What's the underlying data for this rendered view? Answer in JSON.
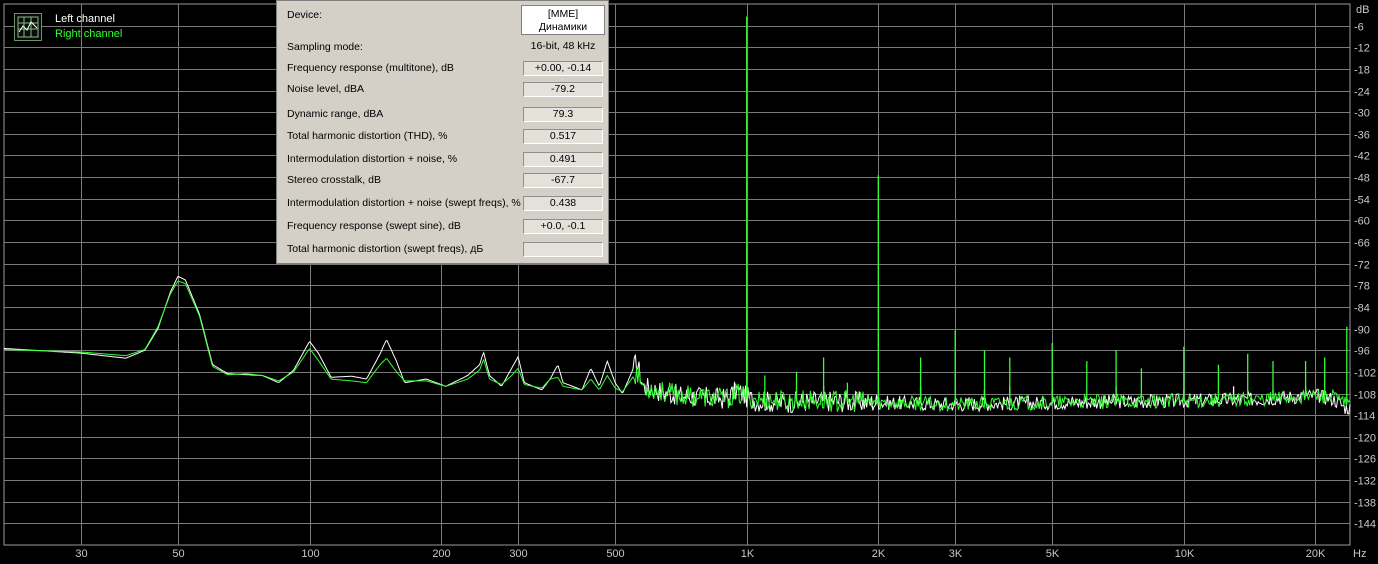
{
  "legend": {
    "items": [
      {
        "label": "Left channel",
        "color": "#ffffff"
      },
      {
        "label": "Right channel",
        "color": "#33ff33"
      }
    ]
  },
  "panel": {
    "device_label": "Device:",
    "device_value_line1": "[MME]",
    "device_value_line2": "Динамики",
    "rows": [
      {
        "label": "Sampling mode:",
        "value": "16-bit, 48 kHz",
        "boxed": false
      },
      {
        "label": "Frequency response (multitone), dB",
        "value": "+0.00, -0.14",
        "boxed": true
      },
      {
        "label": "Noise level, dBA",
        "value": "-79.2",
        "boxed": true
      },
      {
        "label": "Dynamic range, dBA",
        "value": "79.3",
        "boxed": true
      },
      {
        "label": "Total harmonic distortion (THD), %",
        "value": "0.517",
        "boxed": true
      },
      {
        "label": "Intermodulation distortion + noise, %",
        "value": "0.491",
        "boxed": true
      },
      {
        "label": "Stereo crosstalk, dB",
        "value": "-67.7",
        "boxed": true
      },
      {
        "label": "Intermodulation distortion + noise (swept freqs), %",
        "value": "0.438",
        "boxed": true
      },
      {
        "label": "Frequency response (swept sine), dB",
        "value": "+0.0, -0.1",
        "boxed": true
      },
      {
        "label": "Total harmonic distortion (swept freqs), дБ",
        "value": "",
        "boxed": true
      }
    ]
  },
  "chart_data": {
    "type": "line",
    "xscale": "log",
    "xlim": [
      20,
      24000
    ],
    "ylim": [
      -150,
      0
    ],
    "grid": true,
    "legend_position": "top-left",
    "xunit": "Hz",
    "yunit": "dB",
    "x_ticks": [
      {
        "v": 30,
        "label": "30"
      },
      {
        "v": 50,
        "label": "50"
      },
      {
        "v": 100,
        "label": "100"
      },
      {
        "v": 200,
        "label": "200"
      },
      {
        "v": 300,
        "label": "300"
      },
      {
        "v": 500,
        "label": "500"
      },
      {
        "v": 1000,
        "label": "1K"
      },
      {
        "v": 2000,
        "label": "2K"
      },
      {
        "v": 3000,
        "label": "3K"
      },
      {
        "v": 5000,
        "label": "5K"
      },
      {
        "v": 10000,
        "label": "10K"
      },
      {
        "v": 20000,
        "label": "20K"
      }
    ],
    "y_ticks": [
      -6,
      -12,
      -18,
      -24,
      -30,
      -36,
      -42,
      -48,
      -54,
      -60,
      -66,
      -72,
      -78,
      -84,
      -90,
      -96,
      -102,
      -108,
      -114,
      -120,
      -126,
      -132,
      -138,
      -144
    ],
    "series": [
      {
        "name": "Left channel",
        "color": "#ffffff",
        "points": [
          [
            20,
            -95.5
          ],
          [
            30,
            -96.8
          ],
          [
            38,
            -98.2
          ],
          [
            42,
            -96
          ],
          [
            45,
            -90
          ],
          [
            48,
            -80
          ],
          [
            50,
            -75.5
          ],
          [
            52,
            -76.5
          ],
          [
            56,
            -86
          ],
          [
            60,
            -100
          ],
          [
            65,
            -102.5
          ],
          [
            72,
            -102.8
          ],
          [
            78,
            -103
          ],
          [
            85,
            -105
          ],
          [
            92,
            -101.5
          ],
          [
            100,
            -93.5
          ],
          [
            105,
            -97
          ],
          [
            112,
            -103.5
          ],
          [
            125,
            -103.2
          ],
          [
            135,
            -104
          ],
          [
            145,
            -97
          ],
          [
            150,
            -93
          ],
          [
            158,
            -99
          ],
          [
            165,
            -105
          ],
          [
            185,
            -104
          ],
          [
            205,
            -106
          ],
          [
            230,
            -103
          ],
          [
            245,
            -100
          ],
          [
            250,
            -96.5
          ],
          [
            258,
            -103
          ],
          [
            275,
            -106
          ],
          [
            290,
            -101
          ],
          [
            300,
            -97.8
          ],
          [
            310,
            -105
          ],
          [
            340,
            -107
          ],
          [
            355,
            -104
          ],
          [
            370,
            -100
          ],
          [
            380,
            -105
          ],
          [
            420,
            -107
          ],
          [
            440,
            -101
          ],
          [
            460,
            -106
          ],
          [
            480,
            -99
          ],
          [
            500,
            -105
          ],
          [
            520,
            -108
          ],
          [
            560,
            -99
          ],
          [
            580,
            -106
          ],
          [
            640,
            -107.5
          ],
          [
            700,
            -108.5
          ],
          [
            800,
            -109
          ],
          [
            900,
            -109.5
          ],
          [
            950,
            -107
          ],
          [
            1000,
            -109
          ],
          [
            1050,
            -110
          ],
          [
            1200,
            -110.5
          ],
          [
            1500,
            -110
          ],
          [
            2000,
            -110.5
          ],
          [
            3000,
            -111
          ],
          [
            5000,
            -110.5
          ],
          [
            10000,
            -110
          ],
          [
            15000,
            -109.5
          ],
          [
            20000,
            -108.5
          ],
          [
            22000,
            -109.5
          ],
          [
            23500,
            -112
          ]
        ],
        "harmonics": [
          [
            1500,
            -106
          ],
          [
            2500,
            -106
          ],
          [
            3500,
            -107
          ],
          [
            4000,
            -106
          ],
          [
            5000,
            -107
          ],
          [
            7000,
            -106
          ],
          [
            10000,
            -107
          ],
          [
            13000,
            -106
          ],
          [
            16000,
            -107
          ],
          [
            19000,
            -106
          ]
        ]
      },
      {
        "name": "Right channel",
        "color": "#33ff33",
        "points": [
          [
            20,
            -95.8
          ],
          [
            30,
            -96.5
          ],
          [
            38,
            -97.5
          ],
          [
            42,
            -95.8
          ],
          [
            45,
            -89.5
          ],
          [
            48,
            -80.5
          ],
          [
            50,
            -76.8
          ],
          [
            52,
            -77.5
          ],
          [
            56,
            -86.5
          ],
          [
            60,
            -100.5
          ],
          [
            65,
            -102.8
          ],
          [
            72,
            -102.5
          ],
          [
            78,
            -103
          ],
          [
            85,
            -104.5
          ],
          [
            92,
            -102
          ],
          [
            100,
            -95.5
          ],
          [
            105,
            -99
          ],
          [
            112,
            -104
          ],
          [
            125,
            -104.5
          ],
          [
            135,
            -105
          ],
          [
            145,
            -100
          ],
          [
            150,
            -98.2
          ],
          [
            158,
            -102
          ],
          [
            165,
            -104.5
          ],
          [
            185,
            -104.5
          ],
          [
            205,
            -106
          ],
          [
            230,
            -104
          ],
          [
            245,
            -101.5
          ],
          [
            250,
            -98.5
          ],
          [
            258,
            -104
          ],
          [
            275,
            -105.5
          ],
          [
            290,
            -103
          ],
          [
            300,
            -101
          ],
          [
            310,
            -105.5
          ],
          [
            340,
            -106.5
          ],
          [
            355,
            -104
          ],
          [
            370,
            -103.5
          ],
          [
            380,
            -106
          ],
          [
            420,
            -107
          ],
          [
            440,
            -104
          ],
          [
            460,
            -107
          ],
          [
            480,
            -103
          ],
          [
            500,
            -106.5
          ],
          [
            520,
            -107.5
          ],
          [
            560,
            -102
          ],
          [
            580,
            -106
          ],
          [
            640,
            -107.5
          ],
          [
            700,
            -108.5
          ],
          [
            800,
            -109
          ],
          [
            900,
            -109.5
          ],
          [
            950,
            -108
          ],
          [
            1000,
            -109
          ],
          [
            1050,
            -109.5
          ],
          [
            1200,
            -110
          ],
          [
            1500,
            -110
          ],
          [
            2000,
            -110.5
          ],
          [
            3000,
            -111
          ],
          [
            5000,
            -110.5
          ],
          [
            10000,
            -110
          ],
          [
            15000,
            -109.5
          ],
          [
            20000,
            -108.5
          ],
          [
            22000,
            -109
          ],
          [
            23500,
            -111
          ]
        ],
        "harmonics": [
          [
            1000,
            -3.5
          ],
          [
            1100,
            -103
          ],
          [
            1300,
            -102
          ],
          [
            1500,
            -98
          ],
          [
            1700,
            -105
          ],
          [
            2000,
            -47.5
          ],
          [
            2500,
            -98
          ],
          [
            3000,
            -90.5
          ],
          [
            3500,
            -96
          ],
          [
            4000,
            -98
          ],
          [
            5000,
            -94
          ],
          [
            6000,
            -99
          ],
          [
            7000,
            -96
          ],
          [
            8000,
            -101
          ],
          [
            10000,
            -95
          ],
          [
            12000,
            -100
          ],
          [
            14000,
            -97
          ],
          [
            16000,
            -99
          ],
          [
            19000,
            -99
          ],
          [
            21000,
            -98
          ],
          [
            23600,
            -89.5
          ]
        ]
      }
    ]
  }
}
